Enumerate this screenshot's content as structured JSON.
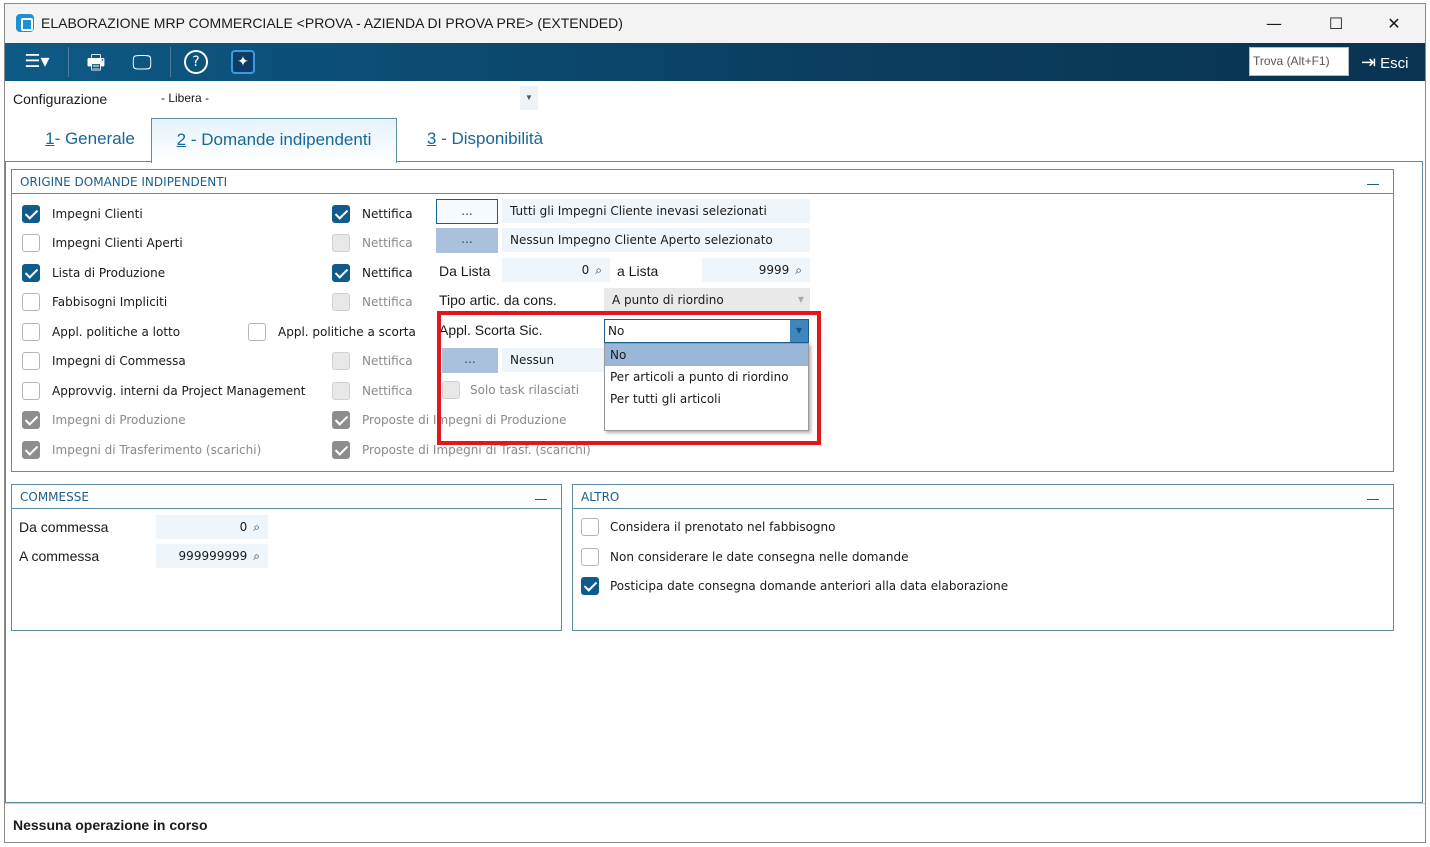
{
  "window": {
    "title": "ELABORAZIONE MRP COMMERCIALE <PROVA - AZIENDA DI PROVA PRE> (EXTENDED)",
    "minimize": "—",
    "maximize": "☐",
    "close": "✕"
  },
  "toolbar": {
    "menu": "☰▾",
    "print": "🖶",
    "monitor": "🖵",
    "help": "?",
    "ai": "✦",
    "search_placeholder": "Trova (Alt+F1)",
    "exit": "Esci",
    "exit_icon": "⇥"
  },
  "config": {
    "label": "Configurazione",
    "value": "- Libera -"
  },
  "tabs": [
    {
      "num": "1",
      "label": "- Generale"
    },
    {
      "num": "2",
      "label": " - Domande indipendenti"
    },
    {
      "num": "3",
      "label": " - Disponibilità"
    }
  ],
  "origine": {
    "title": "ORIGINE DOMANDE INDIPENDENTI",
    "rows": [
      {
        "label": "Impegni Clienti",
        "checked": true,
        "disabled": false,
        "c2": "Nettifica",
        "c2checked": true,
        "c2disabled": false
      },
      {
        "label": "Impegni Clienti Aperti",
        "checked": false,
        "disabled": false,
        "c2": "Nettifica",
        "c2checked": false,
        "c2disabled": true
      },
      {
        "label": "Lista di Produzione",
        "checked": true,
        "disabled": false,
        "c2": "Nettifica",
        "c2checked": true,
        "c2disabled": false
      },
      {
        "label": "Fabbisogni Impliciti",
        "checked": false,
        "disabled": false,
        "c2": "Nettifica",
        "c2checked": false,
        "c2disabled": true
      },
      {
        "label": "Appl. politiche a lotto",
        "checked": false,
        "disabled": false,
        "c2": "Appl. politiche a scorta",
        "c2checked": false,
        "c2disabled": false
      },
      {
        "label": "Impegni di Commessa",
        "checked": false,
        "disabled": false,
        "c2": "Nettifica",
        "c2checked": false,
        "c2disabled": true
      },
      {
        "label": "Approvvig. interni da Project Management",
        "checked": false,
        "disabled": false,
        "c2": "Nettifica",
        "c2checked": false,
        "c2disabled": true
      },
      {
        "label": "Impegni di Produzione",
        "checked": true,
        "disabled": true,
        "c2": "Proposte di Impegni di Produzione",
        "c2checked": true,
        "c2disabled": true
      },
      {
        "label": "Impegni di Trasferimento (scarichi)",
        "checked": true,
        "disabled": true,
        "c2": "Proposte di Impegni di Trasf. (scarichi)",
        "c2checked": true,
        "c2disabled": true
      }
    ],
    "ellipsis": "...",
    "sel1": "Tutti gli Impegni Cliente inevasi selezionati",
    "sel2": "Nessun Impegno Cliente Aperto selezionato",
    "da_lista_label": "Da Lista",
    "da_lista": "0",
    "a_lista_label": "a Lista",
    "a_lista": "9999",
    "tipo_label": "Tipo artic. da cons.",
    "tipo_value": "A punto di riordino",
    "scorta_label": "Appl. Scorta Sic.",
    "scorta_value": "No",
    "scorta_options": [
      "No",
      "Per articoli a punto di riordino",
      "Per tutti gli articoli"
    ],
    "sel3": "Nessun Impegno",
    "solo_task": "Solo task rilasciati"
  },
  "commesse": {
    "title": "COMMESSE",
    "da_label": "Da commessa",
    "da": "0",
    "a_label": "A commessa",
    "a": "999999999"
  },
  "altro": {
    "title": "ALTRO",
    "items": [
      {
        "label": "Considera il prenotato nel fabbisogno",
        "checked": false
      },
      {
        "label": "Non considerare le date consegna nelle domande",
        "checked": false
      },
      {
        "label": "Posticipa date consegna domande anteriori alla data elaborazione",
        "checked": true
      }
    ]
  },
  "status": "Nessuna operazione in corso",
  "colors": {
    "accent": "#0f5c8c",
    "highlight": "#e3161d"
  }
}
